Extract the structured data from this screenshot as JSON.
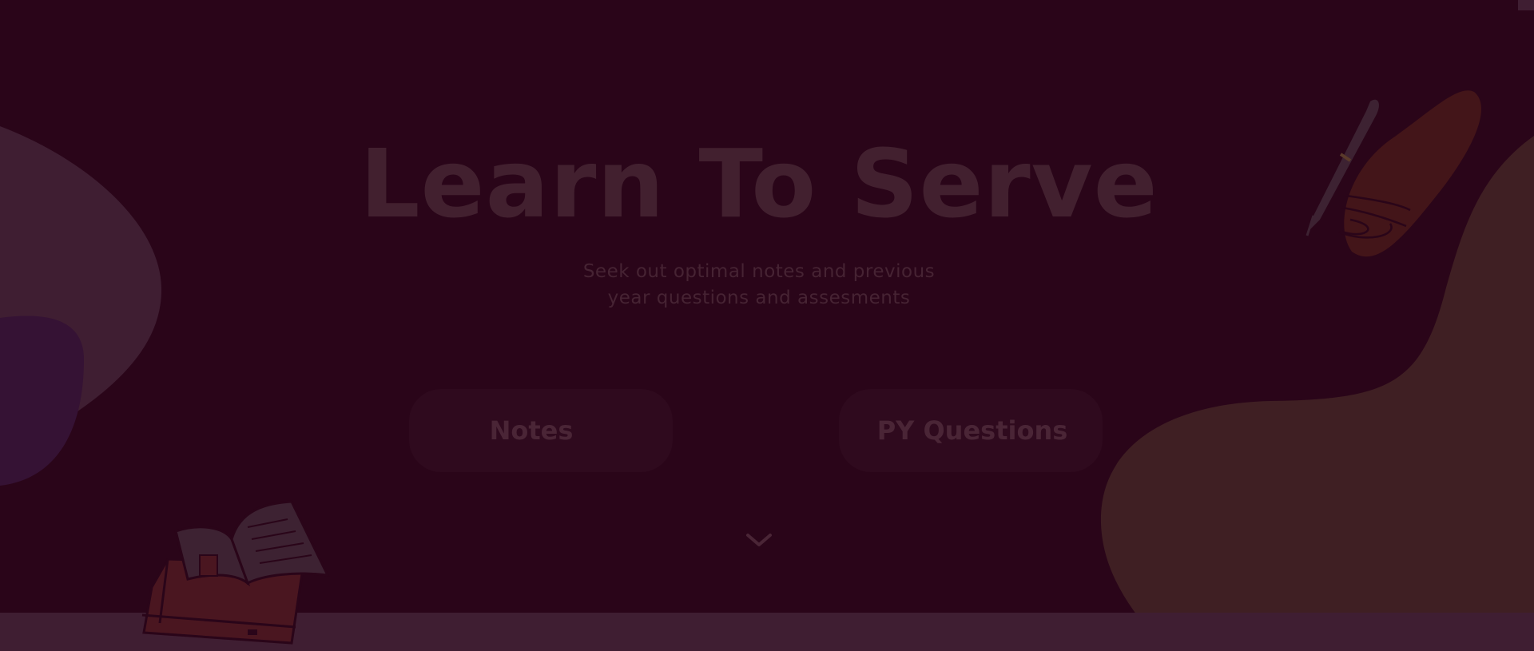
{
  "hero": {
    "title": "Learn To Serve",
    "subtitle": "Seek out optimal notes and previous year questions and assesments"
  },
  "actions": {
    "notes_label": "Notes",
    "py_questions_label": "PY Questions"
  },
  "icons": {
    "scroll_down": "chevron-down-icon",
    "books": "open-book-stack-illustration",
    "pen": "fountain-pen-illustration"
  },
  "colors": {
    "background": "#2a0519",
    "blob_left": "#3f1e32",
    "blob_left_inner": "#351234",
    "blob_right": "#3f1f23",
    "leaf_red": "#431519",
    "text_title": "#42202f",
    "button_bg": "#2f0a1e",
    "button_text": "#4a2536"
  }
}
